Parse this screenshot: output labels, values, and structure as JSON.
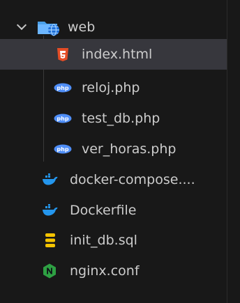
{
  "tree": {
    "folder": {
      "label": "web",
      "expanded": true
    },
    "children": [
      {
        "label": "index.html",
        "icon": "html5-icon",
        "selected": true
      },
      {
        "label": "reloj.php",
        "icon": "php-icon"
      },
      {
        "label": "test_db.php",
        "icon": "php-icon"
      },
      {
        "label": "ver_horas.php",
        "icon": "php-icon"
      }
    ],
    "files": [
      {
        "label": "docker-compose....",
        "icon": "docker-icon"
      },
      {
        "label": "Dockerfile",
        "icon": "docker-icon"
      },
      {
        "label": "init_db.sql",
        "icon": "database-icon"
      },
      {
        "label": "nginx.conf",
        "icon": "nginx-icon"
      }
    ]
  },
  "colors": {
    "background": "#181818",
    "selected_row": "#37373d",
    "text": "#cccccc",
    "html5": "#e44d26",
    "php": "#4f8ef7",
    "docker": "#2496ed",
    "database": "#f5c400",
    "nginx": "#2ea043"
  }
}
